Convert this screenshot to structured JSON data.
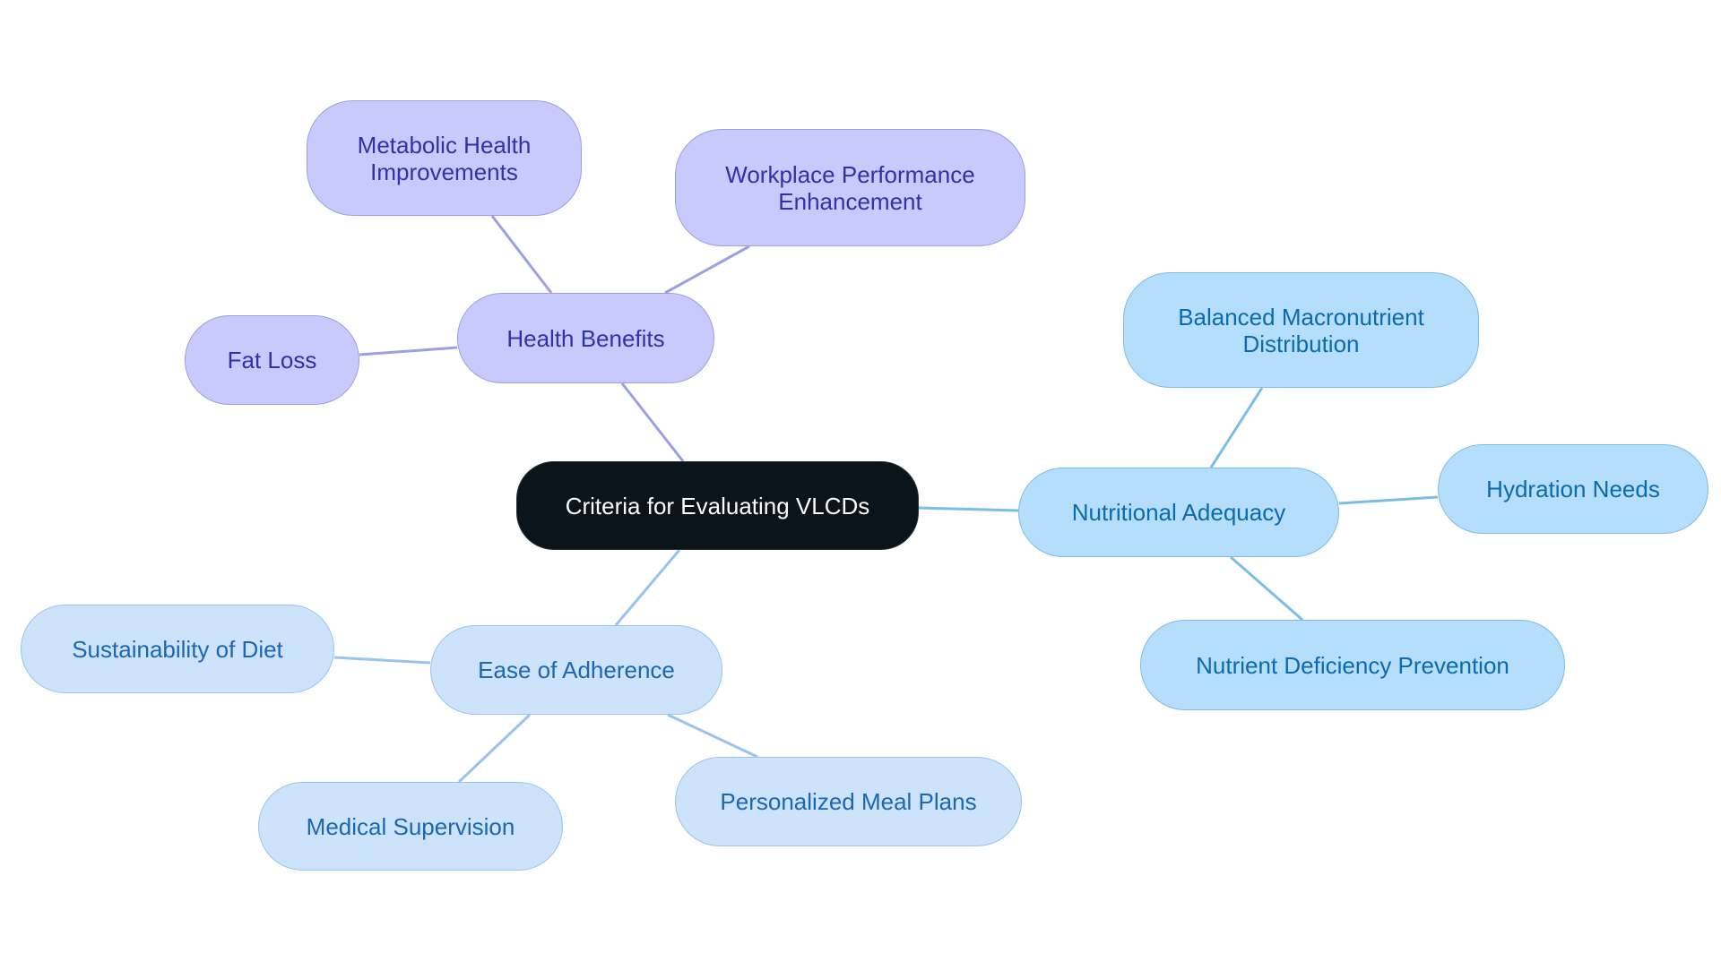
{
  "diagram": {
    "type": "mind-map",
    "root": {
      "id": "root",
      "label": "Criteria for Evaluating VLCDs"
    },
    "branches": [
      {
        "id": "health",
        "label": "Health Benefits",
        "theme": "health",
        "children": [
          {
            "id": "metabolic",
            "label": "Metabolic Health\nImprovements"
          },
          {
            "id": "workplace",
            "label": "Workplace Performance\nEnhancement"
          },
          {
            "id": "fatloss",
            "label": "Fat Loss"
          }
        ]
      },
      {
        "id": "nutri",
        "label": "Nutritional Adequacy",
        "theme": "nutri",
        "children": [
          {
            "id": "balanced",
            "label": "Balanced Macronutrient\nDistribution"
          },
          {
            "id": "hydration",
            "label": "Hydration Needs"
          },
          {
            "id": "deficiency",
            "label": "Nutrient Deficiency Prevention"
          }
        ]
      },
      {
        "id": "ease",
        "label": "Ease of Adherence",
        "theme": "ease",
        "children": [
          {
            "id": "sustain",
            "label": "Sustainability of Diet"
          },
          {
            "id": "medical",
            "label": "Medical Supervision"
          },
          {
            "id": "meal",
            "label": "Personalized Meal Plans"
          }
        ]
      }
    ],
    "colors": {
      "root_fill": "#0c141b",
      "root_text": "#ffffff",
      "health_fill": "#c8cafd",
      "health_stroke": "#9c9fe4",
      "health_text": "#2f32a8",
      "nutri_fill": "#b4defc",
      "nutri_stroke": "#7cbde6",
      "nutri_text": "#0a6bb0",
      "ease_fill": "#cce3fb",
      "ease_stroke": "#99c3ec",
      "ease_text": "#1a67b6"
    }
  }
}
